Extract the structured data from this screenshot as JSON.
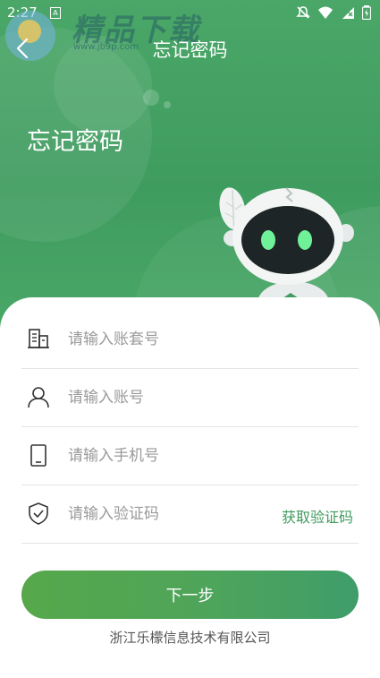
{
  "status_bar": {
    "time": "2:27",
    "a_icon": "A",
    "icons": [
      "bell-off-icon",
      "wifi-icon",
      "signal-icon",
      "battery-icon"
    ]
  },
  "watermark": {
    "title": "精品下载",
    "url": "www.jb9p.com"
  },
  "header": {
    "back_icon": "chevron-left-icon",
    "title": "忘记密码"
  },
  "hero": {
    "title": "忘记密码"
  },
  "form": {
    "account_set": {
      "placeholder": "请输入账套号",
      "icon": "building-icon"
    },
    "account": {
      "placeholder": "请输入账号",
      "icon": "user-icon"
    },
    "phone": {
      "placeholder": "请输入手机号",
      "icon": "phone-icon"
    },
    "code": {
      "placeholder": "请输入验证码",
      "icon": "shield-icon",
      "action_label": "获取验证码"
    }
  },
  "next_button_label": "下一步",
  "footer_text": "浙江乐檬信息技术有限公司",
  "colors": {
    "primary_green": "#45a25f",
    "link_green": "#3f9a5d"
  }
}
